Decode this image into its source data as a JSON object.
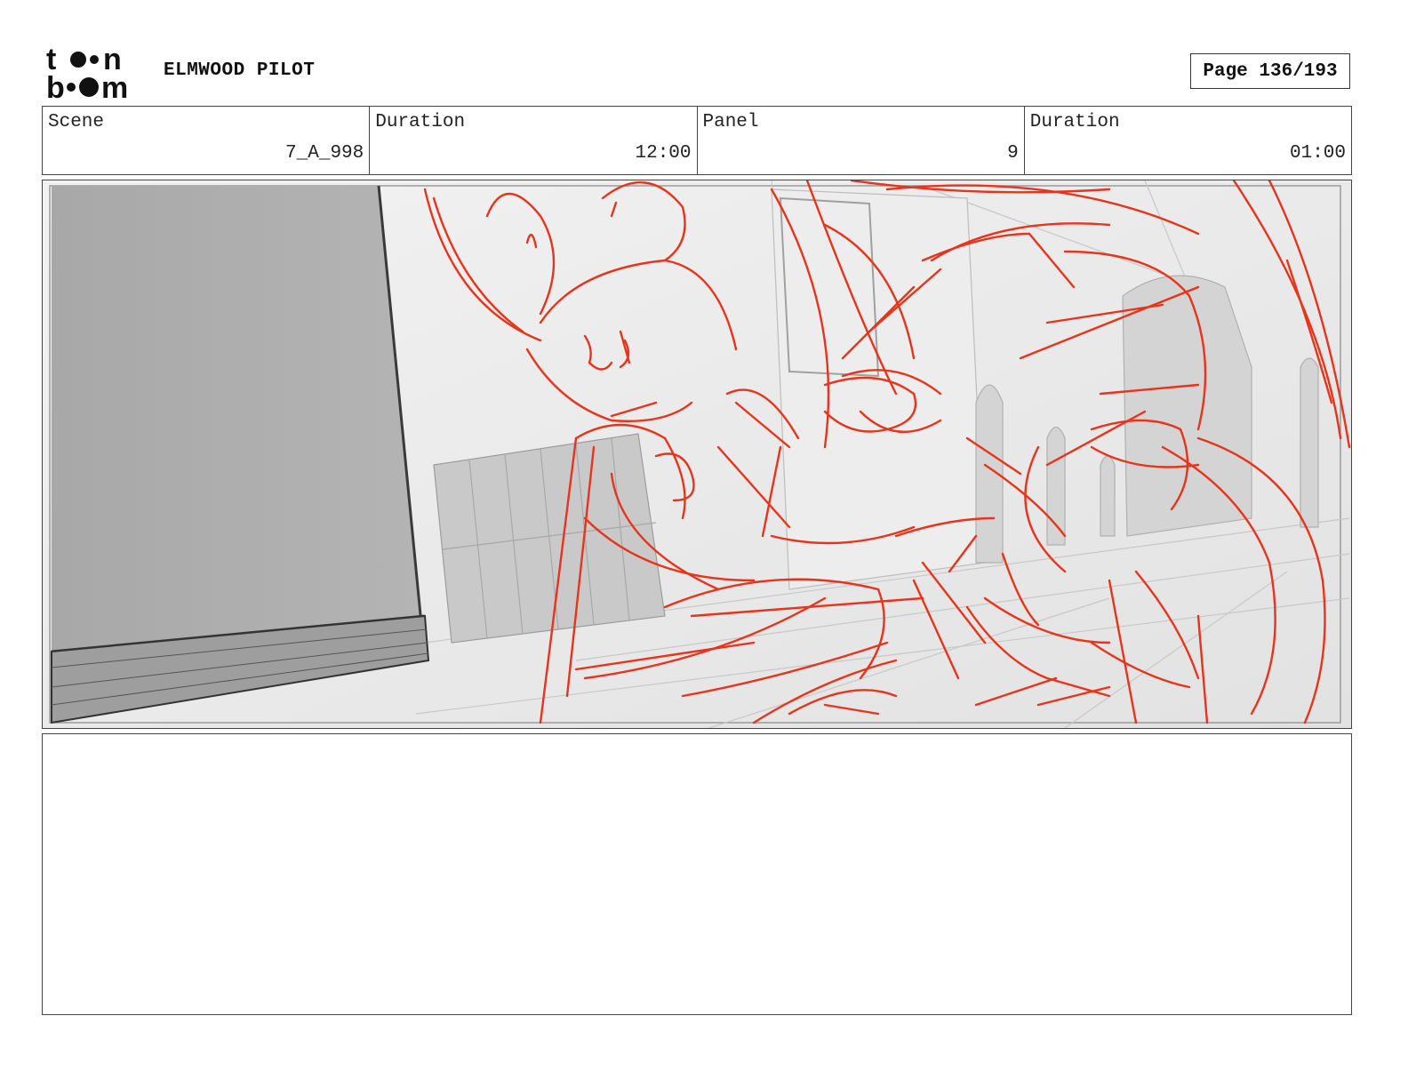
{
  "header": {
    "logo_text": "toon boom",
    "project_title": "ELMWOOD PILOT",
    "page_label": "Page 136/193"
  },
  "info": {
    "scene_label": "Scene",
    "scene_value": "7_A_998",
    "scene_duration_label": "Duration",
    "scene_duration_value": "12:00",
    "panel_label": "Panel",
    "panel_value": "9",
    "panel_duration_label": "Duration",
    "panel_duration_value": "01:00"
  },
  "colors": {
    "sketch_red": "#e8341a",
    "background_grey": "#ececec"
  }
}
